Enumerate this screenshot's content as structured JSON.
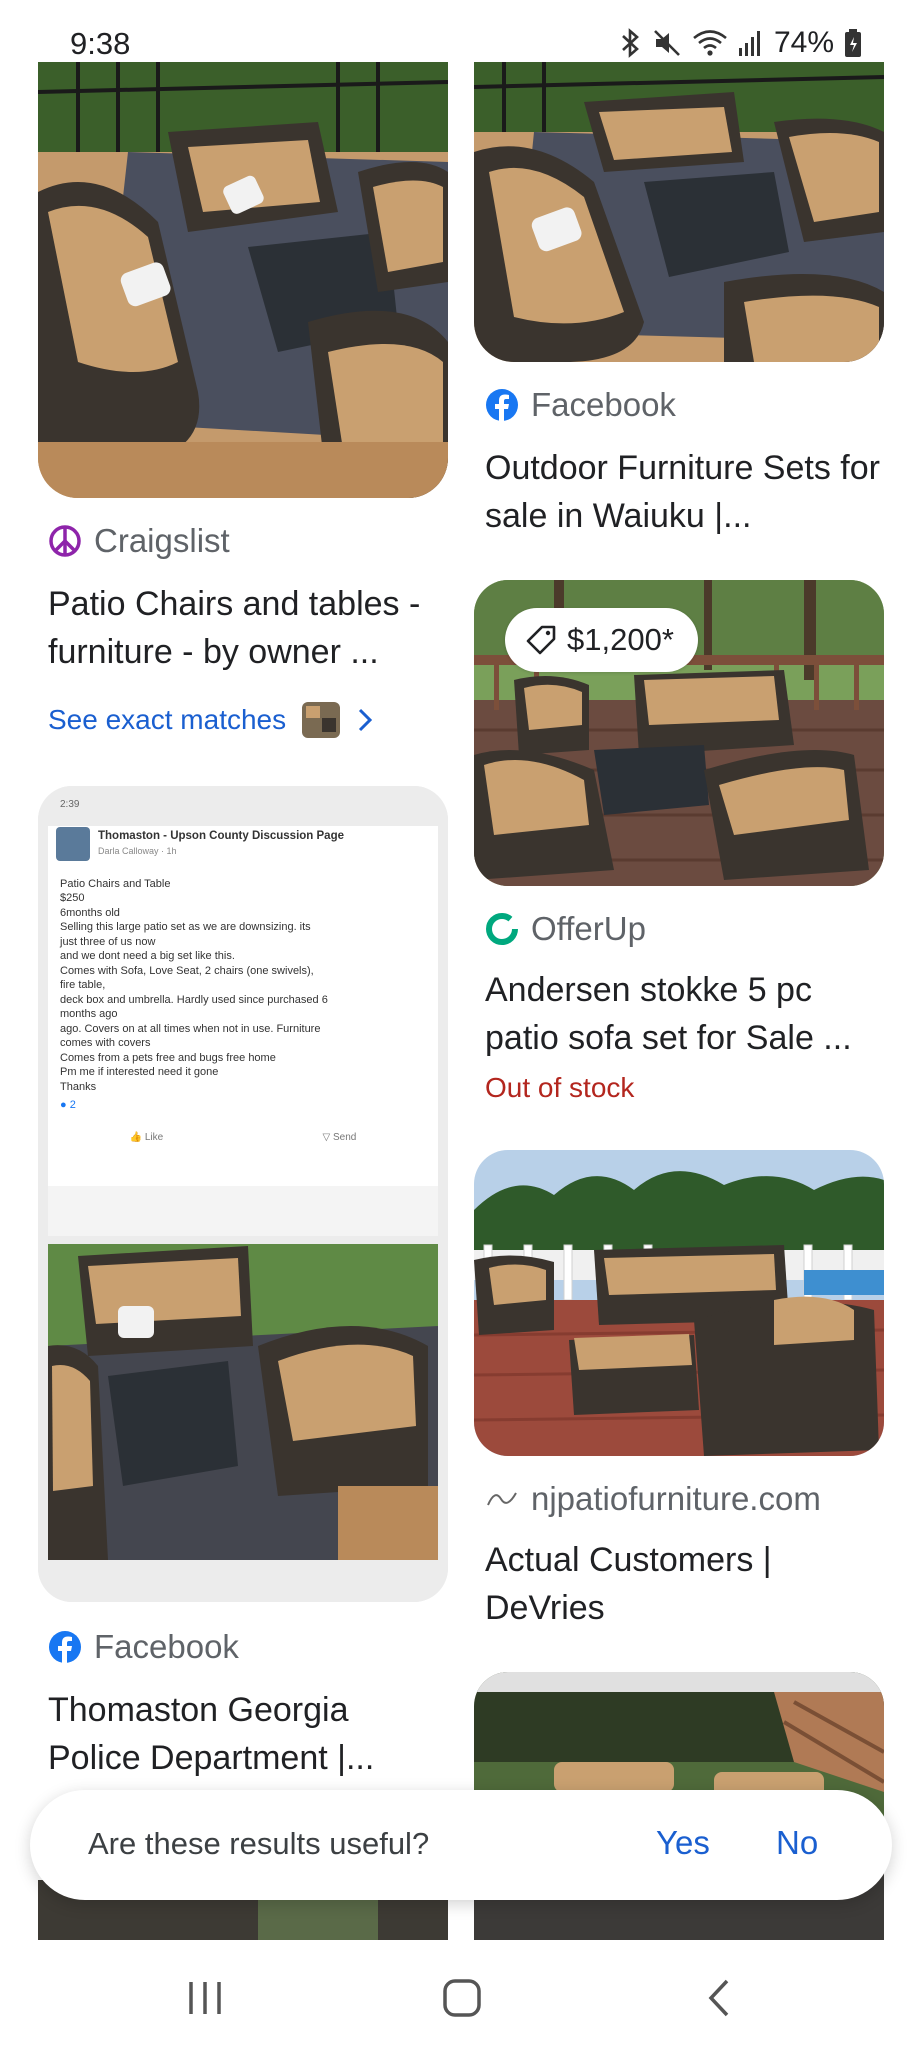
{
  "status_bar": {
    "time": "9:38",
    "battery": "74%"
  },
  "results": [
    {
      "source": "Craigslist",
      "source_icon": "peace-icon",
      "title": "Patio Chairs and tables - furniture - by owner ...",
      "link": "See exact matches"
    },
    {
      "source": "Facebook",
      "source_icon": "facebook-icon",
      "title": "Outdoor Furniture Sets for sale in Waiuku |..."
    },
    {
      "source": "OfferUp",
      "source_icon": "offerup-icon",
      "price": "$1,200*",
      "title": "Andersen stokke 5 pc patio sofa set for Sale ...",
      "stock": "Out of stock"
    },
    {
      "source": "njpatiofurniture.com",
      "source_icon": "devries-logo",
      "title": "Actual Customers | DeVries"
    },
    {
      "source": "Facebook",
      "source_icon": "facebook-icon",
      "title": "Thomaston Georgia Police Department |..."
    }
  ],
  "screenshot_post": {
    "time": "2:39",
    "group": "Thomaston - Upson County Discussion Page",
    "author": "Darla Calloway · 1h",
    "lines": [
      "Patio Chairs and Table",
      "$250",
      "6months old",
      "Selling this large patio set as we are downsizing. its",
      "just three of us now",
      "and we dont need a big set like this.",
      "Comes with Sofa, Love Seat, 2 chairs (one swivels),",
      "fire table,",
      "deck box and umbrella. Hardly used since purchased 6",
      "months ago",
      "ago. Covers on at all times when not in use. Furniture",
      "comes with covers",
      "Comes from a pets free and bugs free home",
      "Pm me if interested need it gone",
      "Thanks"
    ],
    "reactions": "2",
    "like": "Like",
    "send": "Send"
  },
  "feedback": {
    "question": "Are these results useful?",
    "yes": "Yes",
    "no": "No"
  },
  "colors": {
    "link_blue": "#1a5fd0",
    "out_of_stock_red": "#b3261e",
    "facebook_blue": "#1877f2",
    "craigslist_purple": "#8e24aa",
    "offerup_green": "#00a87e"
  }
}
